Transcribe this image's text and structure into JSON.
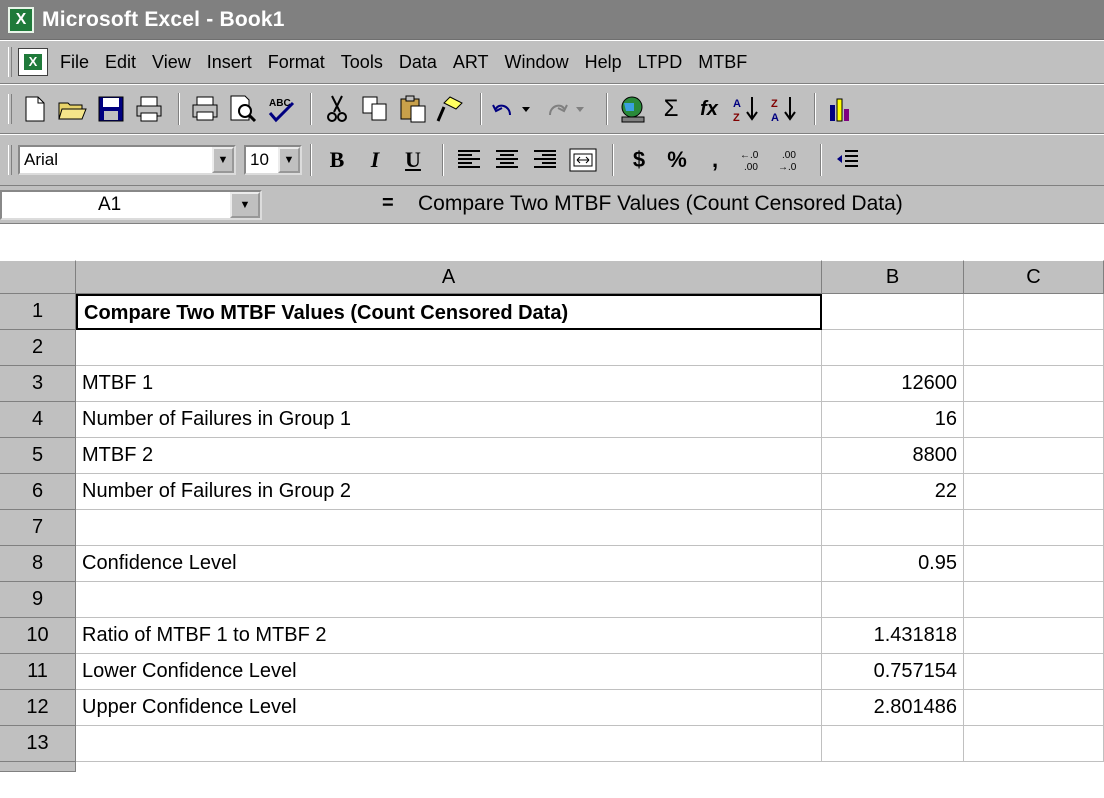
{
  "window": {
    "title": "Microsoft Excel - Book1"
  },
  "menus": [
    "File",
    "Edit",
    "View",
    "Insert",
    "Format",
    "Tools",
    "Data",
    "ART",
    "Window",
    "Help",
    "LTPD",
    "MTBF"
  ],
  "toolbar": {
    "icons": [
      "new-icon",
      "open-icon",
      "save-icon",
      "print-setup-icon",
      "print-icon",
      "print-preview-icon",
      "spelling-icon",
      "cut-icon",
      "copy-icon",
      "paste-icon",
      "format-painter-icon",
      "undo-icon",
      "redo-icon",
      "web-icon",
      "autosum-icon",
      "function-icon",
      "sort-asc-icon",
      "sort-desc-icon",
      "chart-wizard-icon"
    ]
  },
  "format": {
    "font": "Arial",
    "size": "10",
    "bold": "B",
    "italic": "I",
    "underline": "U",
    "currency": "$",
    "percent": "%",
    "comma": ","
  },
  "formula_bar": {
    "cell_ref": "A1",
    "equals": "=",
    "content": "Compare Two MTBF Values (Count Censored Data)"
  },
  "columns": [
    "A",
    "B",
    "C"
  ],
  "rows": [
    {
      "num": "1",
      "a": "Compare Two MTBF Values (Count Censored Data)",
      "b": ""
    },
    {
      "num": "2",
      "a": "",
      "b": ""
    },
    {
      "num": "3",
      "a": "MTBF 1",
      "b": "12600"
    },
    {
      "num": "4",
      "a": "Number of Failures in Group 1",
      "b": "16"
    },
    {
      "num": "5",
      "a": "MTBF 2",
      "b": "8800"
    },
    {
      "num": "6",
      "a": "Number of Failures in Group 2",
      "b": "22"
    },
    {
      "num": "7",
      "a": "",
      "b": ""
    },
    {
      "num": "8",
      "a": "Confidence Level",
      "b": "0.95"
    },
    {
      "num": "9",
      "a": "",
      "b": ""
    },
    {
      "num": "10",
      "a": "Ratio of MTBF 1 to MTBF 2",
      "b": "1.431818"
    },
    {
      "num": "11",
      "a": "Lower Confidence Level",
      "b": "0.757154"
    },
    {
      "num": "12",
      "a": "Upper Confidence Level",
      "b": "2.801486"
    },
    {
      "num": "13",
      "a": "",
      "b": ""
    }
  ]
}
